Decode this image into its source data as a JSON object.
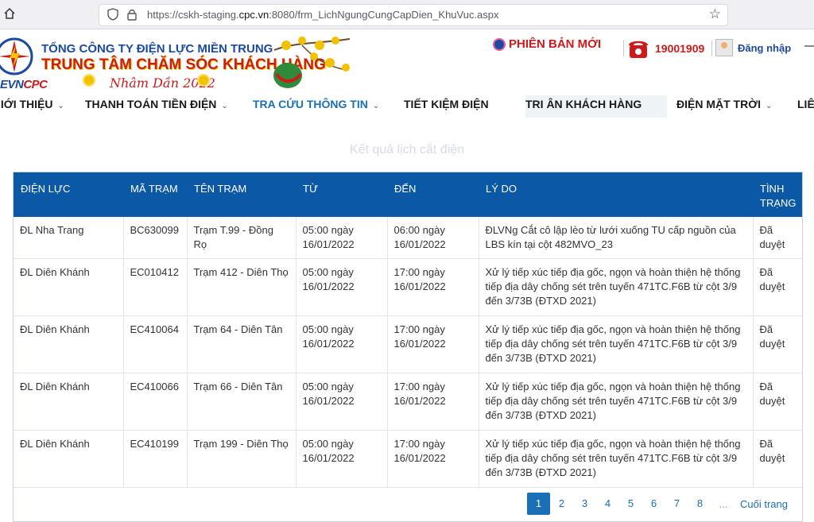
{
  "browser": {
    "url_prefix": "https://cskh-staging.",
    "url_domain": "cpc.vn",
    "url_suffix": ":8080/frm_LichNgungCungCapDien_KhuVuc.aspx"
  },
  "header": {
    "company": "TỔNG CÔNG TY ĐIỆN LỰC MIỀN TRUNG",
    "center": "TRUNG TÂM CHĂM SÓC KHÁCH HÀNG",
    "logo_ev": "EVN",
    "logo_cpc": "CPC",
    "year_text": "Nhâm Dần 2022",
    "new_version": "PHIÊN BẢN MỚI",
    "hotline": "19001909",
    "login": "Đăng nhập"
  },
  "nav": [
    {
      "label": "GIỚI THIỆU",
      "chevron": true
    },
    {
      "label": "THANH TOÁN TIỀN ĐIỆN",
      "chevron": true
    },
    {
      "label": "TRA CỨU THÔNG TIN",
      "chevron": true
    },
    {
      "label": "TIẾT KIỆM ĐIỆN",
      "chevron": false
    },
    {
      "label": "TRI ÂN KHÁCH HÀNG",
      "chevron": false
    },
    {
      "label": "ĐIỆN MẶT TRỜI",
      "chevron": true
    },
    {
      "label": "LIÊN HỆ",
      "chevron": false
    }
  ],
  "page_title": "Kết quả lịch cắt điện",
  "table": {
    "headers": [
      "ĐIỆN LỰC",
      "MÃ TRẠM",
      "TÊN TRẠM",
      "TỪ",
      "ĐẾN",
      "LÝ DO",
      "TÌNH TRẠNG"
    ],
    "rows": [
      [
        "ĐL Nha Trang",
        "BC630099",
        "Trạm T.99 - Đồng Rọ",
        "05:00 ngày 16/01/2022",
        "06:00 ngày 16/01/2022",
        "ĐLVNg Cắt cô lập lèo từ lưới xuống TU cấp nguồn của LBS kín tại cột 482MVO_23",
        "Đã duyệt"
      ],
      [
        "ĐL Diên Khánh",
        "EC010412",
        "Trạm 412 - Diên Thọ",
        "05:00 ngày 16/01/2022",
        "17:00 ngày 16/01/2022",
        "Xử lý tiếp xúc tiếp địa gốc, ngọn và hoàn thiện hệ thống tiếp địa dây chống sét trên tuyến 471TC.F6B từ cột 3/9 đến 3/73B (ĐTXD 2021)",
        "Đã duyệt"
      ],
      [
        "ĐL Diên Khánh",
        "EC410064",
        "Trạm 64 - Diên Tân",
        "05:00 ngày 16/01/2022",
        "17:00 ngày 16/01/2022",
        "Xử lý tiếp xúc tiếp địa gốc, ngọn và hoàn thiện hệ thống tiếp địa dây chống sét trên tuyến 471TC.F6B từ cột 3/9 đến 3/73B (ĐTXD 2021)",
        "Đã duyệt"
      ],
      [
        "ĐL Diên Khánh",
        "EC410066",
        "Trạm 66 - Diên Tân",
        "05:00 ngày 16/01/2022",
        "17:00 ngày 16/01/2022",
        "Xử lý tiếp xúc tiếp địa gốc, ngọn và hoàn thiện hệ thống tiếp địa dây chống sét trên tuyến 471TC.F6B từ cột 3/9 đến 3/73B (ĐTXD 2021)",
        "Đã duyệt"
      ],
      [
        "ĐL Diên Khánh",
        "EC410199",
        "Trạm 199 - Diên Thọ",
        "05:00 ngày 16/01/2022",
        "17:00 ngày 16/01/2022",
        "Xử lý tiếp xúc tiếp địa gốc, ngọn và hoàn thiện hệ thống tiếp địa dây chống sét trên tuyến 471TC.F6B từ cột 3/9 đến 3/73B (ĐTXD 2021)",
        "Đã duyệt"
      ]
    ]
  },
  "pagination": {
    "pages": [
      "1",
      "2",
      "3",
      "4",
      "5",
      "6",
      "7",
      "8"
    ],
    "current": "1",
    "ellipsis": "...",
    "last_label": "Cuối trang"
  },
  "colors": {
    "brand_blue": "#0b58a7",
    "link_blue": "#1b6fb5",
    "brand_red": "#cc1b1b"
  }
}
